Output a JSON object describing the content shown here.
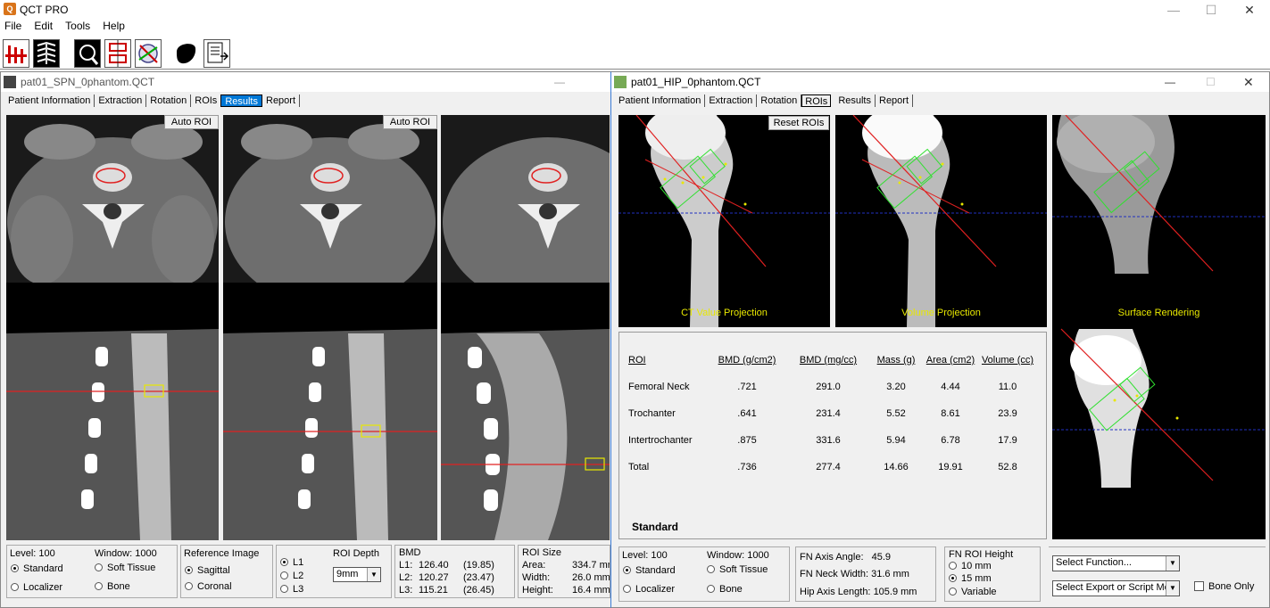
{
  "app": {
    "title": "QCT PRO",
    "icon_text": "Q"
  },
  "menu": [
    "File",
    "Edit",
    "Tools",
    "Help"
  ],
  "toolbar_icons": [
    "spine-measure-icon",
    "ribcage-icon",
    "zoom-icon",
    "calibration-icon",
    "network-icon",
    "organ-icon",
    "export-icon"
  ],
  "spn": {
    "title": "pat01_SPN_0phantom.QCT",
    "tabs": [
      "Patient Information",
      "Extraction",
      "Rotation",
      "ROIs",
      "Results",
      "Report"
    ],
    "auto_roi_label": "Auto ROI",
    "level_label": "Level:",
    "level_value": "100",
    "window_label": "Window:",
    "window_value": "1000",
    "modes": [
      "Standard",
      "Soft Tissue",
      "Localizer",
      "Bone"
    ],
    "ref_image_title": "Reference Image",
    "ref_image_options": [
      "Sagittal",
      "Coronal"
    ],
    "levels": [
      "L1",
      "L2",
      "L3"
    ],
    "roi_depth_title": "ROI Depth",
    "roi_depth_value": "9mm",
    "bmd_title": "BMD",
    "bmd_rows": [
      {
        "level": "L1:",
        "value": "126.40",
        "sd": "(19.85)"
      },
      {
        "level": "L2:",
        "value": "120.27",
        "sd": "(23.47)"
      },
      {
        "level": "L3:",
        "value": "115.21",
        "sd": "(26.45)"
      }
    ],
    "roi_size_title": "ROI Size",
    "roi_size_rows": [
      {
        "label": "Area:",
        "value": "334.7 mm"
      },
      {
        "label": "Width:",
        "value": "26.0 mm"
      },
      {
        "label": "Height:",
        "value": "16.4 mm"
      }
    ]
  },
  "hip": {
    "title": "pat01_HIP_0phantom.QCT",
    "tabs": [
      "Patient Information",
      "Extraction",
      "Rotation",
      "ROIs",
      "Results",
      "Report"
    ],
    "reset_rois_label": "Reset ROIs",
    "views": [
      "CT Value Projection",
      "Volume Projection",
      "Surface Rendering"
    ],
    "table_headers": [
      "ROI",
      "BMD (g/cm2)",
      "BMD (mg/cc)",
      "Mass (g)",
      "Area (cm2)",
      "Volume (cc)"
    ],
    "table_rows": [
      [
        "Femoral Neck",
        ".721",
        "291.0",
        "3.20",
        "4.44",
        "11.0"
      ],
      [
        "Trochanter",
        ".641",
        "231.4",
        "5.52",
        "8.61",
        "23.9"
      ],
      [
        "Intertrochanter",
        ".875",
        "331.6",
        "5.94",
        "6.78",
        "17.9"
      ],
      [
        "Total",
        ".736",
        "277.4",
        "14.66",
        "19.91",
        "52.8"
      ]
    ],
    "standard_label": "Standard",
    "level_label": "Level:",
    "level_value": "100",
    "window_label": "Window:",
    "window_value": "1000",
    "modes": [
      "Standard",
      "Soft Tissue",
      "Localizer",
      "Bone"
    ],
    "fn_axis_angle_label": "FN Axis Angle:",
    "fn_axis_angle_value": "45.9",
    "fn_neck_width_label": "FN Neck Width:",
    "fn_neck_width_value": "31.6 mm",
    "hip_axis_length_label": "Hip Axis Length:",
    "hip_axis_length_value": "105.9 mm",
    "fn_roi_height_title": "FN ROI Height",
    "fn_roi_height_options": [
      "10 mm",
      "15 mm",
      "Variable"
    ],
    "select_function": "Select Function...",
    "select_export": "Select Export or Script Meth",
    "bone_only_label": "Bone Only"
  },
  "colors": {
    "accent": "#0078d7",
    "roi_red": "#e02020",
    "roi_yellow": "#e8e800",
    "roi_green": "#30e030"
  }
}
